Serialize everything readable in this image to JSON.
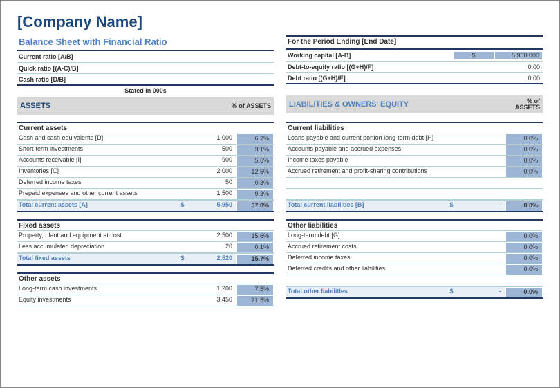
{
  "title": "[Company Name]",
  "left_top": {
    "subtitle": "Balance Sheet with Financial Ratio",
    "rows": [
      {
        "label": "Current ratio  [A/B]",
        "val": ""
      },
      {
        "label": "Quick ratio  [(A-C)/B]",
        "val": ""
      },
      {
        "label": "Cash ratio  [D/B]",
        "val": ""
      }
    ],
    "stated": "Stated in 000s"
  },
  "right_top": {
    "period": "For the Period Ending [End Date]",
    "rows": [
      {
        "label": "Working capital  [A-B]",
        "dollar": "$",
        "amount": "5,950,000",
        "val": ""
      },
      {
        "label": "Debt-to-equity ratio  [(G+H)/F]",
        "dollar": "",
        "amount": "",
        "val": "0.00"
      },
      {
        "label": "Debt ratio  [(G+H)/E]",
        "dollar": "",
        "amount": "",
        "val": "0.00"
      }
    ]
  },
  "catband_left": {
    "label": "ASSETS",
    "pct": "% of ASSETS"
  },
  "catband_right": {
    "label": "LIABILITIES & OWNERS' EQUITY",
    "pct": "% of ASSETS"
  },
  "assets": {
    "current": {
      "header": "Current assets",
      "rows": [
        {
          "label": "Cash and cash equivalents  [D]",
          "val": "1,000",
          "pct": "6.2%"
        },
        {
          "label": "Short-term investments",
          "val": "500",
          "pct": "3.1%"
        },
        {
          "label": "Accounts receivable  [I]",
          "val": "900",
          "pct": "5.6%"
        },
        {
          "label": "Inventories  [C]",
          "val": "2,000",
          "pct": "12.5%"
        },
        {
          "label": "Deferred income taxes",
          "val": "50",
          "pct": "0.3%"
        },
        {
          "label": "Prepaid expenses and other current assets",
          "val": "1,500",
          "pct": "9.3%"
        }
      ],
      "total": {
        "label": "Total current assets  [A]",
        "dollar": "$",
        "val": "5,950",
        "pct": "37.0%"
      }
    },
    "fixed": {
      "header": "Fixed assets",
      "rows": [
        {
          "label": "Property, plant and equipment at cost",
          "val": "2,500",
          "pct": "15.6%"
        },
        {
          "label": "Less accumulated depreciation",
          "val": "20",
          "pct": "0.1%"
        }
      ],
      "total": {
        "label": "Total fixed assets",
        "dollar": "$",
        "val": "2,520",
        "pct": "15.7%"
      }
    },
    "other": {
      "header": "Other assets",
      "rows": [
        {
          "label": "Long-term cash investments",
          "val": "1,200",
          "pct": "7.5%"
        },
        {
          "label": "Equity investments",
          "val": "3,450",
          "pct": "21.5%"
        }
      ]
    }
  },
  "liabilities": {
    "current": {
      "header": "Current liabilities",
      "rows": [
        {
          "label": "Loans payable and current portion long-term debt  [H]",
          "val": "",
          "pct": "0.0%"
        },
        {
          "label": "Accounts payable and accrued expenses",
          "val": "",
          "pct": "0.0%"
        },
        {
          "label": "Income taxes payable",
          "val": "",
          "pct": "0.0%"
        },
        {
          "label": "Accrued retirement and profit-sharing contributions",
          "val": "",
          "pct": "0.0%"
        }
      ],
      "total": {
        "label": "Total current liabilities  [B]",
        "dollar": "$",
        "val": "-",
        "pct": "0.0%"
      }
    },
    "other": {
      "header": "Other liabilities",
      "rows": [
        {
          "label": "Long-term debt  [G]",
          "val": "",
          "pct": "0.0%"
        },
        {
          "label": "Accrued retirement costs",
          "val": "",
          "pct": "0.0%"
        },
        {
          "label": "Deferred income taxes",
          "val": "",
          "pct": "0.0%"
        },
        {
          "label": "Deferred credits and other liabilities",
          "val": "",
          "pct": "0.0%"
        }
      ],
      "total": {
        "label": "Total other liabilities",
        "dollar": "$",
        "val": "-",
        "pct": "0.0%"
      }
    }
  }
}
